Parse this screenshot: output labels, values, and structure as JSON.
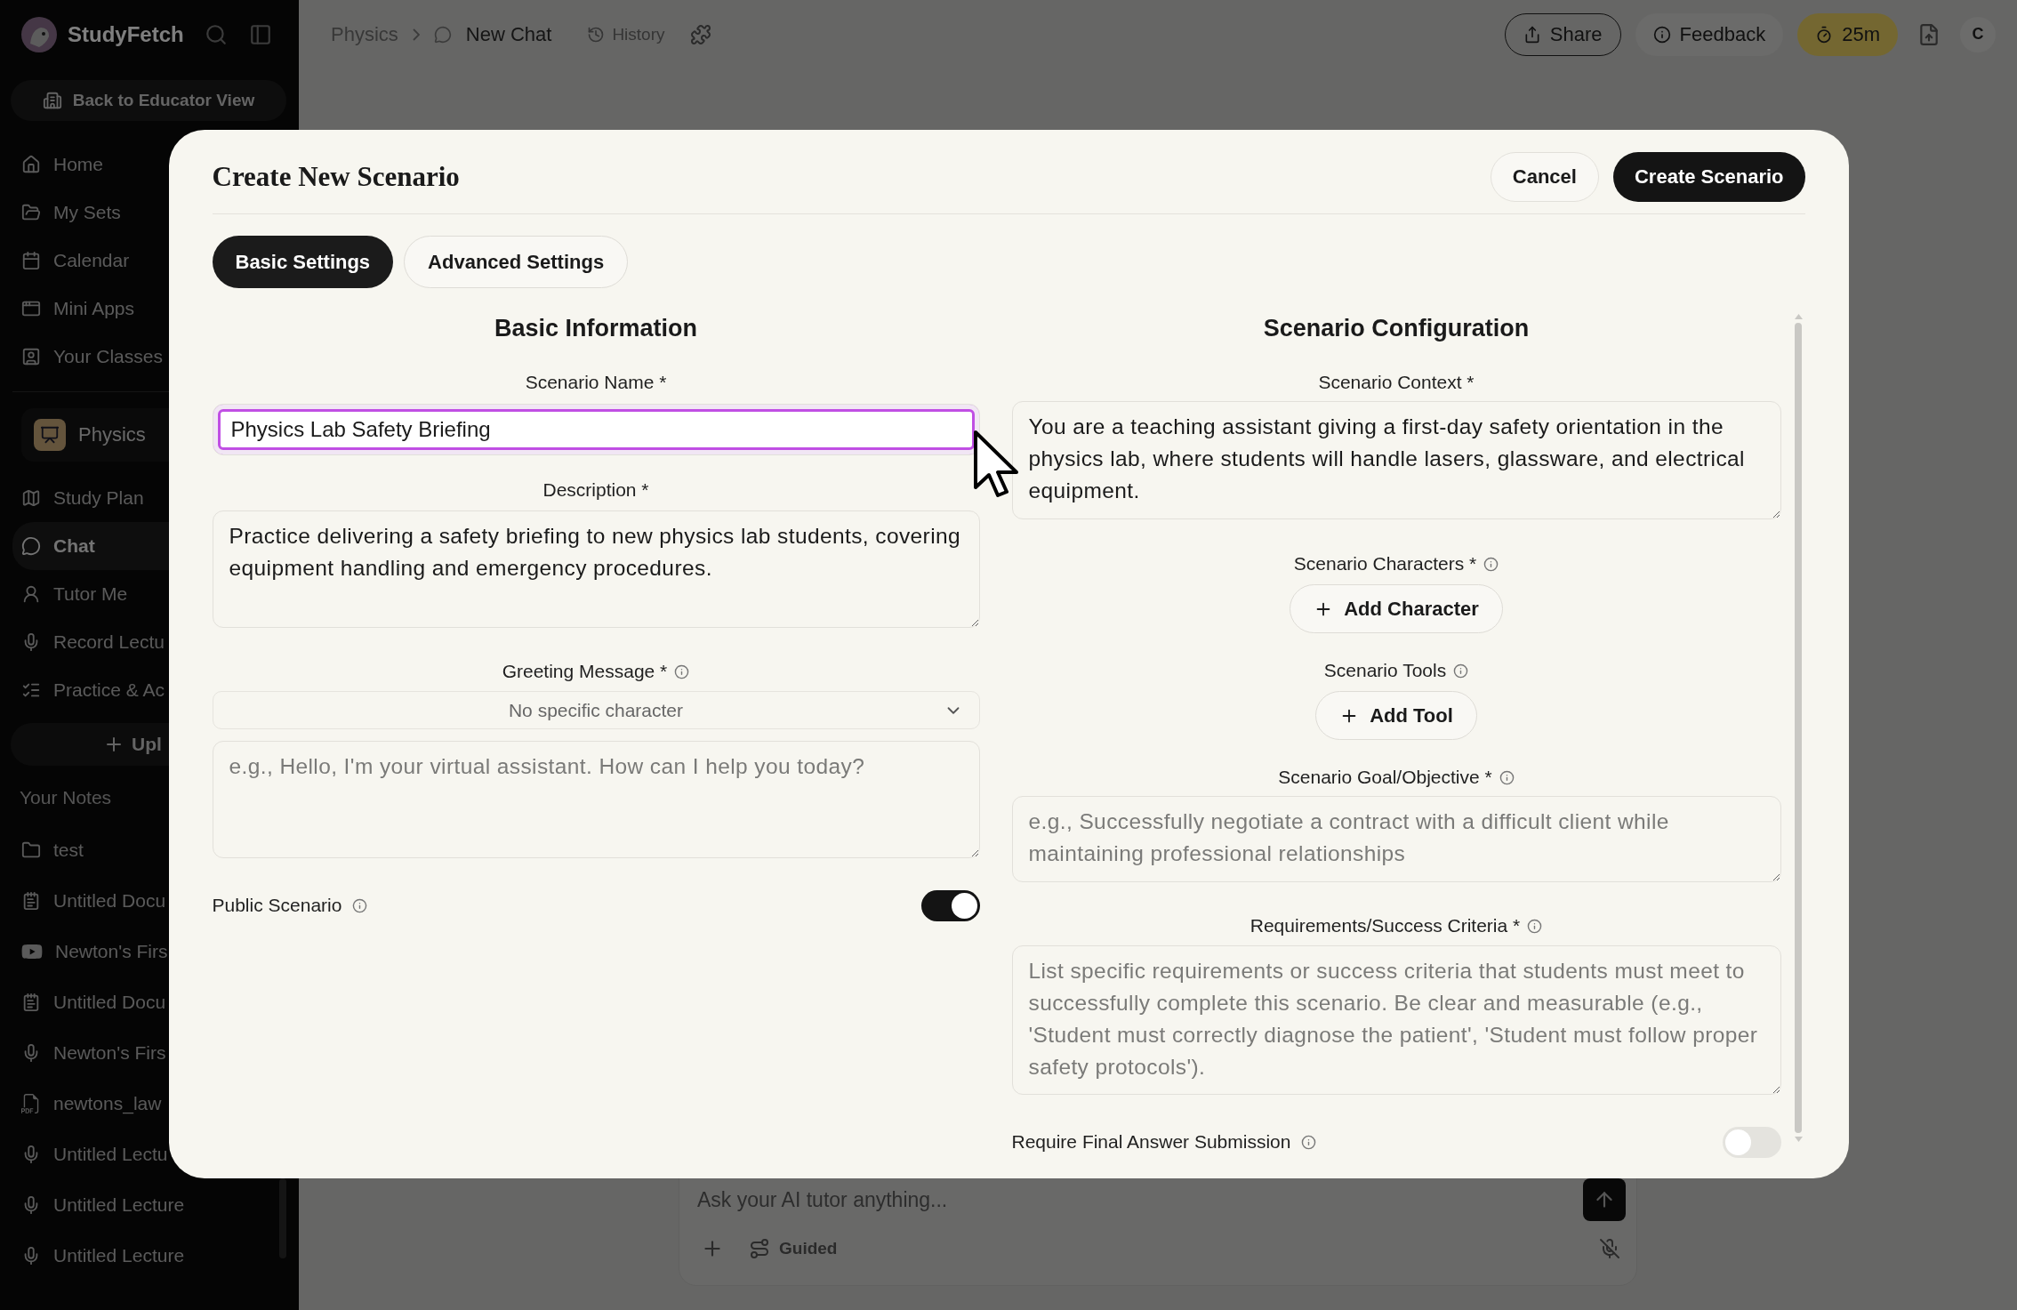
{
  "sidebar": {
    "brand": "StudyFetch",
    "back_button": "Back to Educator View",
    "nav": [
      {
        "label": "Home"
      },
      {
        "label": "My Sets"
      },
      {
        "label": "Calendar"
      },
      {
        "label": "Mini Apps"
      },
      {
        "label": "Your Classes"
      }
    ],
    "course": "Physics",
    "course_nav": [
      {
        "label": "Study Plan",
        "selected": false
      },
      {
        "label": "Chat",
        "selected": true
      },
      {
        "label": "Tutor Me",
        "selected": false
      },
      {
        "label": "Record Lectu",
        "selected": false
      },
      {
        "label": "Practice & Ac",
        "selected": false
      }
    ],
    "upload_button": "Upl",
    "notes_heading": "Your Notes",
    "notes": [
      {
        "label": "test",
        "kind": "folder"
      },
      {
        "label": "Untitled Docu",
        "kind": "document"
      },
      {
        "label": "Newton's Firs",
        "kind": "video"
      },
      {
        "label": "Untitled Docu",
        "kind": "document"
      },
      {
        "label": "Newton's Firs",
        "kind": "audio"
      },
      {
        "label": "newtons_law",
        "kind": "pdf"
      },
      {
        "label": "Untitled Lectu",
        "kind": "audio"
      },
      {
        "label": "Untitled Lecture",
        "kind": "audio"
      },
      {
        "label": "Untitled Lecture",
        "kind": "audio"
      }
    ]
  },
  "topbar": {
    "breadcrumb": "Physics",
    "current": "New Chat",
    "history": "History",
    "share": "Share",
    "feedback": "Feedback",
    "timer": "25m",
    "avatar": "C"
  },
  "chat": {
    "placeholder": "Ask your AI tutor anything...",
    "mode": "Guided"
  },
  "modal": {
    "title": "Create New Scenario",
    "buttons": [
      {
        "label": "Cancel",
        "kind": "secondary"
      },
      {
        "label": "Create Scenario",
        "kind": "primary"
      }
    ],
    "tabs": [
      {
        "label": "Basic Settings",
        "selected": true
      },
      {
        "label": "Advanced Settings",
        "selected": false
      }
    ],
    "left": {
      "heading": "Basic Information",
      "scenario_name": {
        "label": "Scenario Name *",
        "value": "Physics Lab Safety Briefing"
      },
      "description": {
        "label": "Description *",
        "value": "Practice delivering a safety briefing to new physics lab students, covering equipment handling and emergency procedures."
      },
      "greeting": {
        "label": "Greeting Message *",
        "info": true,
        "select": "No specific character",
        "placeholder": "e.g., Hello, I'm your virtual assistant. How can I help you today?"
      },
      "public_scenario": {
        "label": "Public Scenario",
        "info": true,
        "on": true
      }
    },
    "right": {
      "heading": "Scenario Configuration",
      "context": {
        "label": "Scenario Context *",
        "value": "You are a teaching assistant giving a first-day safety orientation in the physics lab, where students will handle lasers, glassware, and electrical equipment."
      },
      "characters": {
        "label": "Scenario Characters *",
        "info": true,
        "button": "Add Character"
      },
      "tools": {
        "label": "Scenario Tools",
        "info": true,
        "button": "Add Tool"
      },
      "goal": {
        "label": "Scenario Goal/Objective *",
        "info": true,
        "placeholder": "e.g., Successfully negotiate a contract with a difficult client while maintaining professional relationships"
      },
      "requirements": {
        "label": "Requirements/Success Criteria *",
        "info": true,
        "placeholder": "List specific requirements or success criteria that students must meet to successfully complete this scenario. Be clear and measurable (e.g., 'Student must correctly diagnose the patient', 'Student must follow proper safety protocols')."
      },
      "final_answer": {
        "label": "Require Final Answer Submission",
        "info": true,
        "on": false
      }
    }
  }
}
